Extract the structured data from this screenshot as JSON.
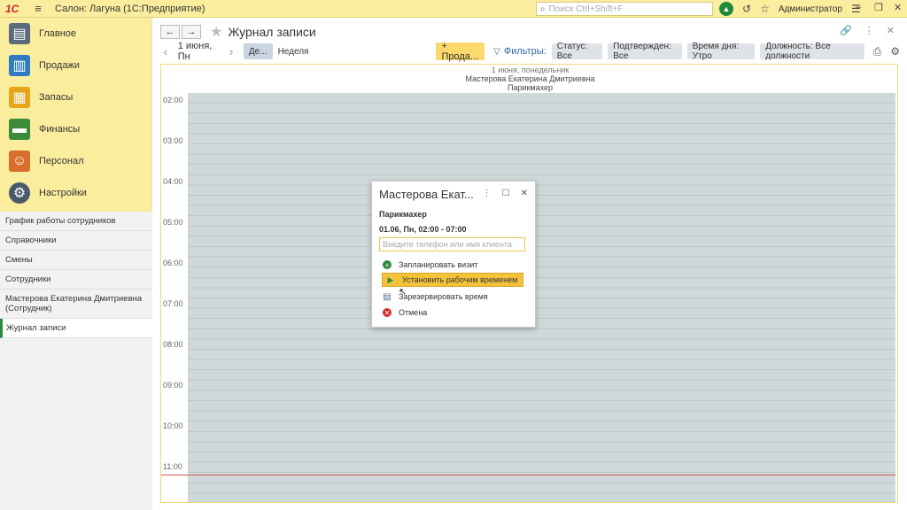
{
  "topbar": {
    "logo": "1С",
    "title": "Салон: Лагуна  (1С:Предприятие)",
    "search_placeholder": "Поиск Ctrl+Shift+F",
    "user": "Администратор"
  },
  "sidebar": {
    "nav": [
      {
        "label": "Главное",
        "icon": "home-icon"
      },
      {
        "label": "Продажи",
        "icon": "sales-chart-icon"
      },
      {
        "label": "Запасы",
        "icon": "stock-icon"
      },
      {
        "label": "Финансы",
        "icon": "wallet-icon"
      },
      {
        "label": "Персонал",
        "icon": "staff-icon"
      },
      {
        "label": "Настройки",
        "icon": "gear-icon"
      }
    ],
    "open_windows": [
      "График работы сотрудников",
      "Справочники",
      "Смены",
      "Сотрудники",
      "Мастерова Екатерина Дмитриевна (Сотрудник)",
      "Журнал записи"
    ],
    "active_window": "Журнал записи"
  },
  "document": {
    "title": "Журнал записи"
  },
  "toolbar": {
    "date": "1 июня, Пн",
    "day_label": "Де...",
    "week_label": "Неделя",
    "add_label": "+ Прода...",
    "filters_label": "Фильтры:",
    "chips": [
      "Статус: Все",
      "Подтвержден: Все",
      "Время дня: Утро",
      "Должность: Все должности"
    ]
  },
  "calendar": {
    "date": "1 июня, понедельник",
    "employee": "Мастерова Екатерина Дмитриевна",
    "position": "Парикмахер",
    "times": [
      "02:00",
      "03:00",
      "04:00",
      "05:00",
      "06:00",
      "07:00",
      "08:00",
      "09:00",
      "10:00",
      "11:00"
    ]
  },
  "popup": {
    "title": "Мастерова Екат...",
    "role": "Парикмахер",
    "time": "01.06, Пн, 02:00 - 07:00",
    "input_placeholder": "Введите телефон или имя клиента",
    "actions": [
      {
        "label": "Запланировать визит",
        "icon": "plus-circle-icon"
      },
      {
        "label": "Установить рабочим временем",
        "icon": "play-icon"
      },
      {
        "label": "Зарезервировать время",
        "icon": "reserve-icon"
      },
      {
        "label": "Отмена",
        "icon": "cancel-icon"
      }
    ],
    "highlighted_action": "Установить рабочим временем"
  }
}
